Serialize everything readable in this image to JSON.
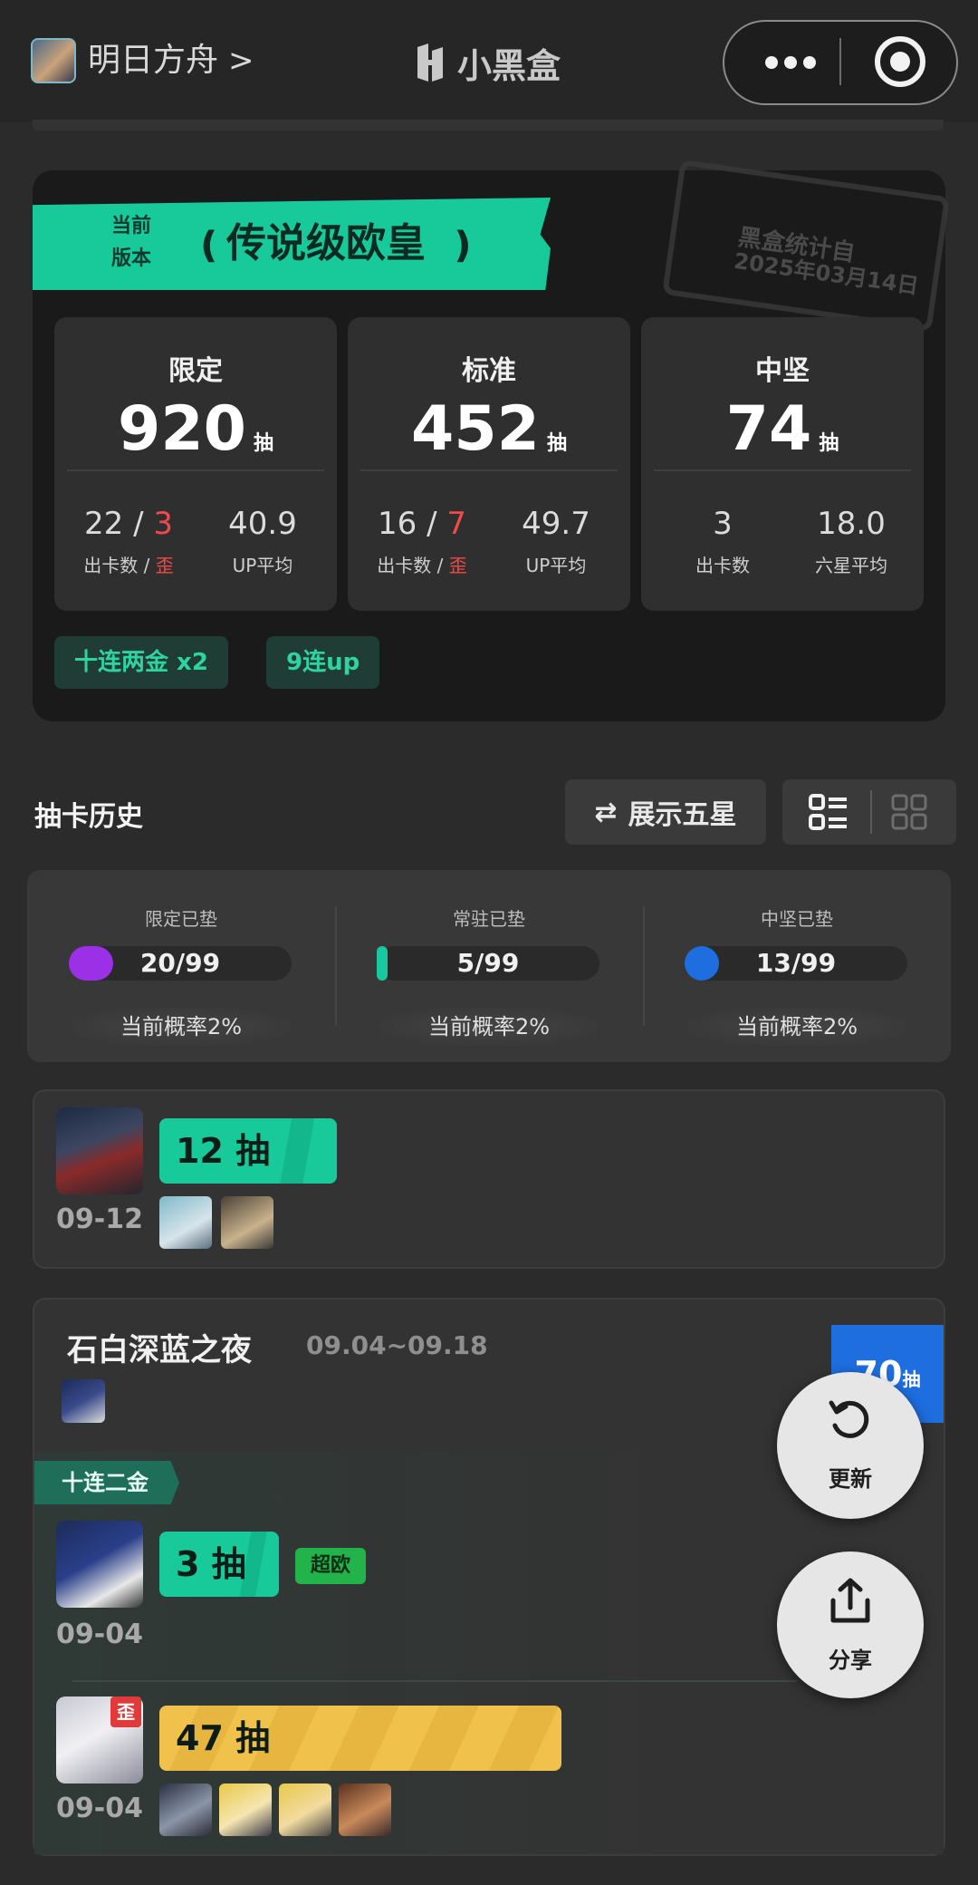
{
  "header": {
    "game_name": "明日方舟",
    "game_chevron": ">",
    "brand": "小黑盒"
  },
  "summary": {
    "ribbon_small_1": "当前",
    "ribbon_small_2": "版本",
    "ribbon_title": "传说级欧皇",
    "stamp_line1": "黑盒统计自",
    "stamp_line2": "2025年03月14日",
    "stats": [
      {
        "title": "限定",
        "total": "920",
        "unit": "抽",
        "left_a": "22",
        "left_sep": " / ",
        "left_b": "3",
        "left_lbl_a": "出卡数 / ",
        "left_lbl_b": "歪",
        "right_val": "40.9",
        "right_lbl": "UP平均"
      },
      {
        "title": "标准",
        "total": "452",
        "unit": "抽",
        "left_a": "16",
        "left_sep": " / ",
        "left_b": "7",
        "left_lbl_a": "出卡数 / ",
        "left_lbl_b": "歪",
        "right_val": "49.7",
        "right_lbl": "UP平均"
      },
      {
        "title": "中坚",
        "total": "74",
        "unit": "抽",
        "left_a": "3",
        "left_lbl_a": "出卡数",
        "right_val": "18.0",
        "right_lbl": "六星平均"
      }
    ],
    "tags": [
      "十连两金  x2",
      "9连up"
    ]
  },
  "history": {
    "title": "抽卡历史",
    "show_five_label": "展示五星",
    "swap_icon": "⇄"
  },
  "pity": [
    {
      "label": "限定已垫",
      "value": "20/99",
      "fraction": 0.2,
      "color": "#9b30e6",
      "rate": "当前概率2%"
    },
    {
      "label": "常驻已垫",
      "value": "5/99",
      "fraction": 0.05,
      "color": "#18c9a0",
      "rate": "当前概率2%"
    },
    {
      "label": "中坚已垫",
      "value": "13/99",
      "fraction": 0.13,
      "color": "#1e6ee0",
      "rate": "当前概率2%"
    }
  ],
  "records": {
    "first": {
      "pulls": "12 抽",
      "date": "09-12"
    },
    "banner": {
      "title": "石白深蓝之夜",
      "dates": "09.04~09.18",
      "count": "70",
      "count_unit": "抽",
      "ten_pull_tag": "十连二金",
      "entries": [
        {
          "pulls": "3 抽",
          "date": "09-04",
          "badge": "超欧"
        },
        {
          "pulls": "47 抽",
          "date": "09-04",
          "badge": "歪"
        }
      ]
    }
  },
  "fabs": {
    "refresh_label": "更新",
    "share_label": "分享"
  }
}
